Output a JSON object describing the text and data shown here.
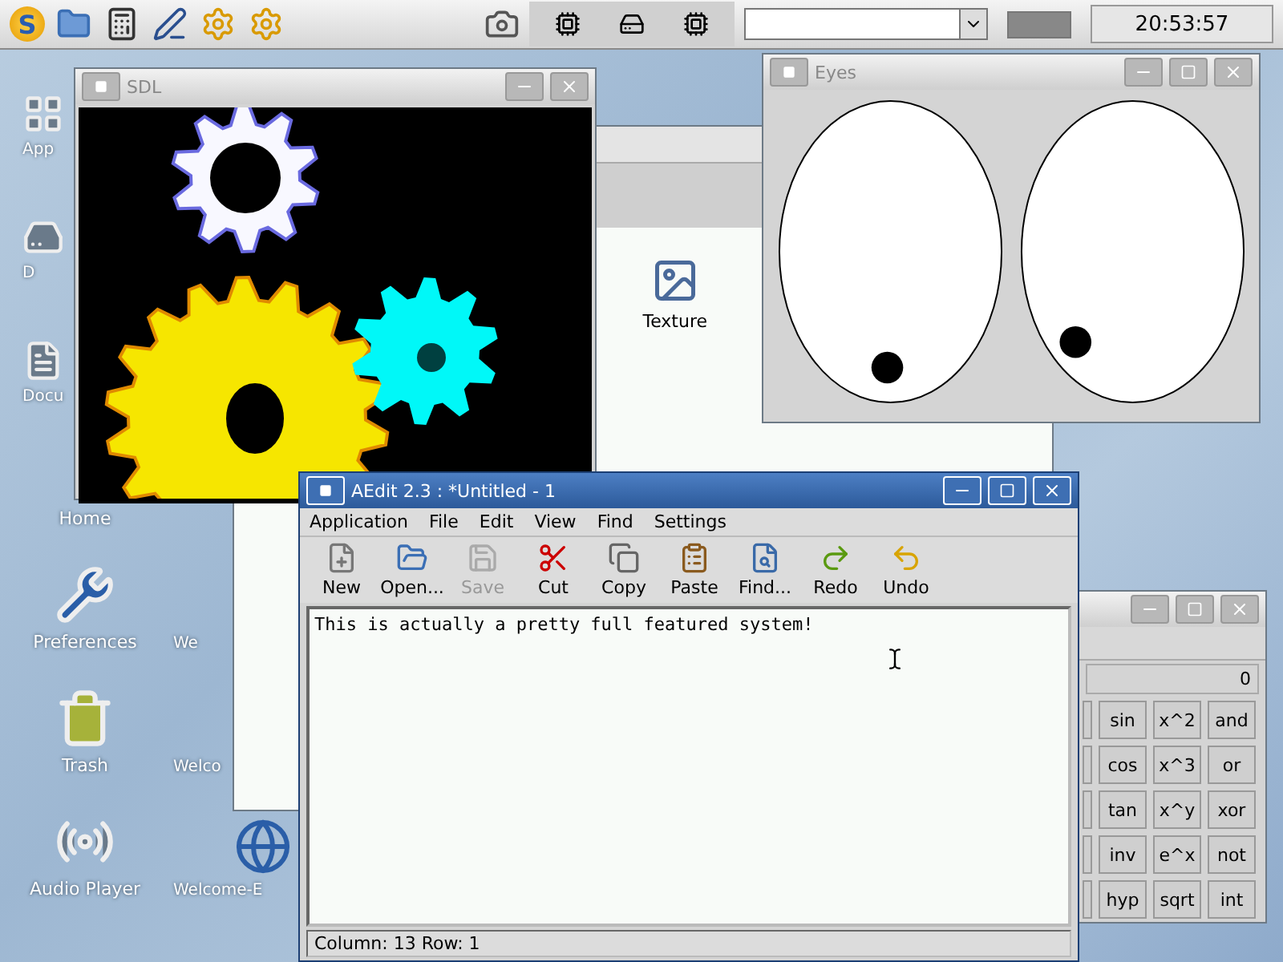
{
  "panel": {
    "logo": "S",
    "launchers": [
      {
        "kind": "folder"
      },
      {
        "kind": "calculator"
      },
      {
        "kind": "editor"
      },
      {
        "kind": "settings"
      },
      {
        "kind": "settings"
      }
    ],
    "clock": "20:53:57"
  },
  "desktop_icons": [
    {
      "label": "App",
      "kind": "apps",
      "covered": true
    },
    {
      "label": "D",
      "kind": "drive",
      "covered": true
    },
    {
      "label": "Docu",
      "kind": "docs",
      "covered": true
    },
    {
      "label": "Home",
      "kind": "hidden",
      "covered": false
    },
    {
      "label": "Preferences",
      "kind": "tools",
      "covered": false
    },
    {
      "label": "Trash",
      "kind": "trash",
      "covered": false
    },
    {
      "label": "Audio Player",
      "kind": "audio",
      "covered": false
    }
  ],
  "desktop_icons_2": [
    {
      "label": "We"
    },
    {
      "label": "Welco"
    },
    {
      "label": "Welcome-E"
    }
  ],
  "file_window": {
    "item": "Texture"
  },
  "sdl_window": {
    "title": "SDL"
  },
  "eyes_window": {
    "title": "Eyes"
  },
  "calculator": {
    "display": "0",
    "buttons": [
      [
        "sin",
        "x^2",
        "and"
      ],
      [
        "cos",
        "x^3",
        "or"
      ],
      [
        "tan",
        "x^y",
        "xor"
      ],
      [
        "inv",
        "e^x",
        "not"
      ],
      [
        "hyp",
        "sqrt",
        "int"
      ]
    ]
  },
  "editor": {
    "title": "AEdit 2.3 : *Untitled - 1",
    "menu": [
      "Application",
      "File",
      "Edit",
      "View",
      "Find",
      "Settings"
    ],
    "toolbar": [
      {
        "label": "New",
        "kind": "new",
        "disabled": false
      },
      {
        "label": "Open...",
        "kind": "open",
        "disabled": false
      },
      {
        "label": "Save",
        "kind": "save",
        "disabled": true
      },
      {
        "label": "Cut",
        "kind": "cut",
        "disabled": false
      },
      {
        "label": "Copy",
        "kind": "copy",
        "disabled": false
      },
      {
        "label": "Paste",
        "kind": "paste",
        "disabled": false
      },
      {
        "label": "Find...",
        "kind": "find",
        "disabled": false
      },
      {
        "label": "Redo",
        "kind": "redo",
        "disabled": false
      },
      {
        "label": "Undo",
        "kind": "undo",
        "disabled": false
      }
    ],
    "text": "This is actually a pretty full featured system!",
    "status": "Column: 13 Row: 1"
  }
}
